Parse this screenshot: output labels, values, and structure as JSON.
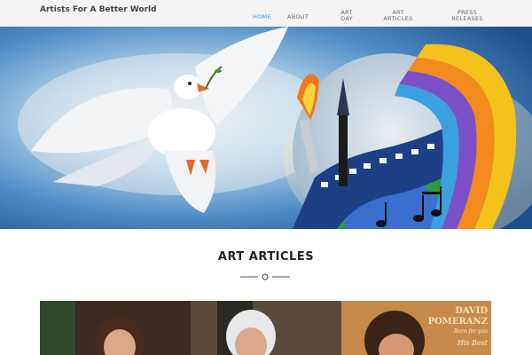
{
  "header": {
    "site_title": "Artists For A Better World",
    "nav": [
      {
        "label": "HOME",
        "active": true
      },
      {
        "label": "ABOUT",
        "active": false
      },
      {
        "label": "ART\nDAY",
        "active": false
      },
      {
        "label": "ART\nARTICLES",
        "active": false
      },
      {
        "label": "PRESS\nRELEASES",
        "active": false
      }
    ]
  },
  "section": {
    "title": "ART ARTICLES"
  },
  "article_image": {
    "album_artist": "DAVID\nPOMERANZ",
    "album_subtitle": "His Best",
    "album_tagline": "Born for you"
  },
  "colors": {
    "accent": "#3a8ed0",
    "header_bg": "#f4f4f4",
    "title_text": "#222222"
  }
}
